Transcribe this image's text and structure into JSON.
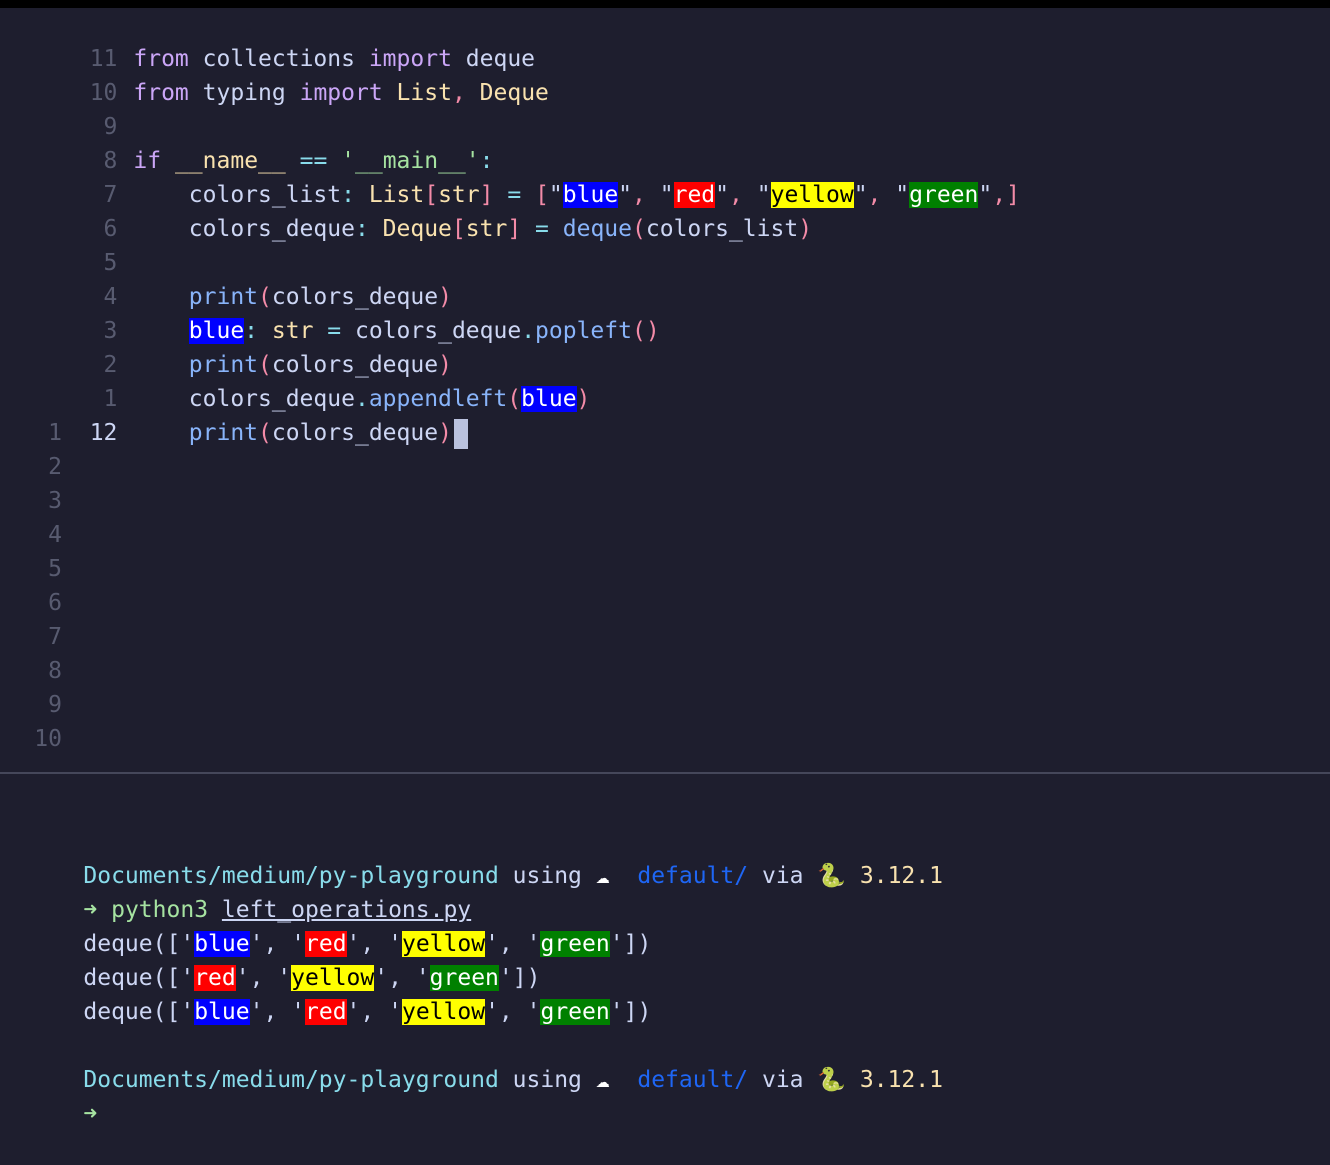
{
  "editor": {
    "line_numbers": [
      "11",
      "10",
      "9",
      "8",
      "7",
      "6",
      "5",
      "4",
      "3",
      "2",
      "1",
      "12",
      "1",
      "2",
      "3",
      "4",
      "5",
      "6",
      "7",
      "8",
      "9",
      "10"
    ],
    "lines": {
      "l1": {
        "kw1": "from",
        "mod": "collections",
        "kw2": "import",
        "name": "deque"
      },
      "l2": {
        "kw1": "from",
        "mod": "typing",
        "kw2": "import",
        "t1": "List",
        "comma": ",",
        "t2": "Deque"
      },
      "l4": {
        "kw": "if",
        "dunder": "__name__",
        "eq": "==",
        "main": "'__main__'",
        "colon": ":"
      },
      "l5": {
        "var": "colors_list",
        "colon": ":",
        "type": "List",
        "br1": "[",
        "ty_str": "str",
        "br2": "]",
        "eq": "=",
        "open": "[",
        "q": "\"",
        "blue": "blue",
        "red": "red",
        "yellow": "yellow",
        "green": "green",
        "sep": ",",
        "trail": ",]"
      },
      "l6": {
        "var": "colors_deque",
        "colon": ":",
        "type": "Deque",
        "br1": "[",
        "ty_str": "str",
        "br2": "]",
        "eq": "=",
        "call": "deque",
        "p1": "(",
        "arg": "colors_list",
        "p2": ")"
      },
      "l8": {
        "call": "print",
        "p1": "(",
        "arg": "colors_deque",
        "p2": ")"
      },
      "l9": {
        "var": "blue",
        "colon": ":",
        "ty": "str",
        "eq": "=",
        "obj": "colors_deque",
        "dot": ".",
        "method": "popleft",
        "parens": "()"
      },
      "l10": {
        "call": "print",
        "p1": "(",
        "arg": "colors_deque",
        "p2": ")"
      },
      "l11": {
        "obj": "colors_deque",
        "dot": ".",
        "method": "appendleft",
        "p1": "(",
        "arg": "blue",
        "p2": ")"
      },
      "l12": {
        "call": "print",
        "p1": "(",
        "arg": "colors_deque",
        "p2": ")"
      }
    }
  },
  "terminal": {
    "prompt": {
      "path": "Documents/medium/py-playground",
      "using": "using",
      "cloud": "☁",
      "context": "default/",
      "via": "via",
      "snake": "🐍",
      "version": "3.12.1",
      "arrow": "➜"
    },
    "command": {
      "exe": "python3",
      "file": "left_operations.py"
    },
    "outputs": [
      {
        "open": "deque([",
        "q": "'",
        "sep": ", ",
        "close": "])",
        "items": [
          "blue",
          "red",
          "yellow",
          "green"
        ]
      },
      {
        "open": "deque([",
        "q": "'",
        "sep": ", ",
        "close": "])",
        "items": [
          "red",
          "yellow",
          "green"
        ]
      },
      {
        "open": "deque([",
        "q": "'",
        "sep": ", ",
        "close": "])",
        "items": [
          "blue",
          "red",
          "yellow",
          "green"
        ]
      }
    ]
  },
  "colors": {
    "blue": "#0000ff",
    "red": "#ff0000",
    "yellow": "#ffff00",
    "green": "#008000",
    "background": "#1e1e2e"
  }
}
